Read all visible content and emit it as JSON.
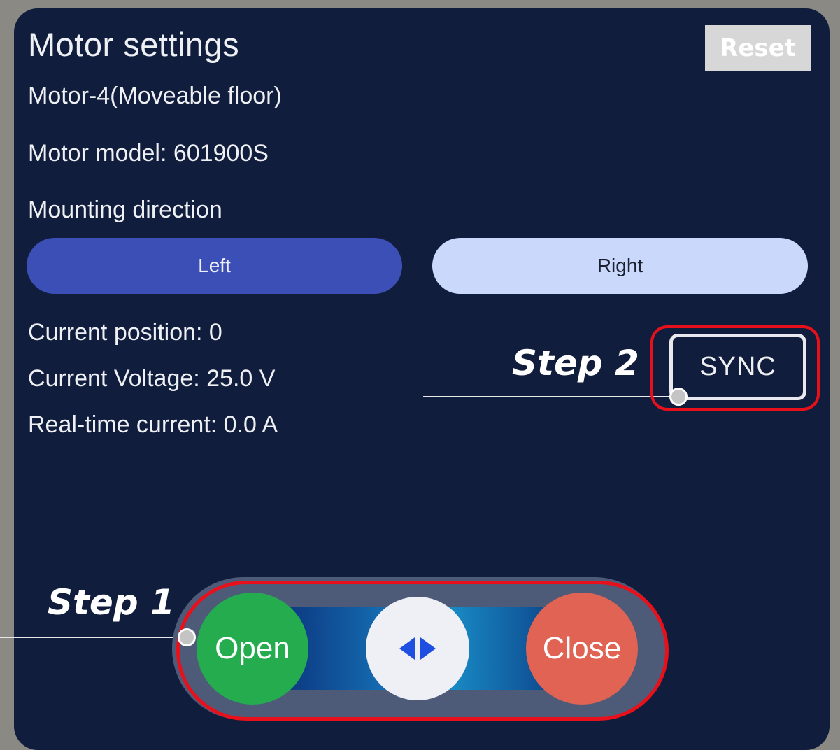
{
  "header": {
    "title": "Motor settings",
    "reset_label": "Reset"
  },
  "motor": {
    "name": "Motor-4(Moveable floor)",
    "model": "Motor model: 601900S"
  },
  "mounting": {
    "label": "Mounting direction",
    "options": [
      {
        "label": "Left",
        "selected": true
      },
      {
        "label": "Right",
        "selected": false
      }
    ]
  },
  "status": {
    "position": "Current position: 0",
    "voltage": "Current Voltage: 25.0 V",
    "current": "Real-time current: 0.0 A"
  },
  "sync": {
    "label": "SYNC"
  },
  "controls": {
    "open_label": "Open",
    "close_label": "Close",
    "middle_icon": "double-arrow-left-right-icon"
  },
  "annotations": {
    "step1": "Step 1",
    "step2": "Step 2"
  },
  "colors": {
    "background": "#111d3c",
    "selected_direction": "#3c4fb6",
    "unselected_direction": "#c9d8fb",
    "open": "#24ac4f",
    "close": "#e06354",
    "highlight": "#e8101a"
  }
}
